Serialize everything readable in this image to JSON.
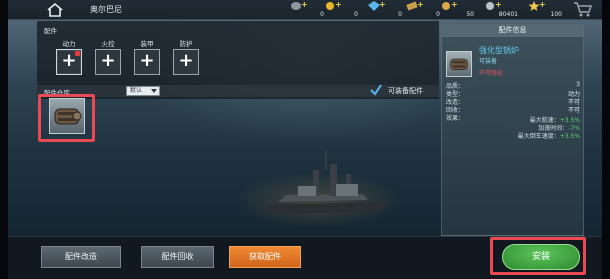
{
  "header": {
    "ship_name": "奥尔巴尼",
    "resources": [
      {
        "icon": "oil-icon",
        "value": "0"
      },
      {
        "icon": "gold-coin-icon",
        "value": "0"
      },
      {
        "icon": "diamond-icon",
        "value": "0"
      },
      {
        "icon": "ticket-icon",
        "value": "0"
      },
      {
        "icon": "medal-icon",
        "value": "50"
      },
      {
        "icon": "silver-coin-icon",
        "value": "80401"
      },
      {
        "icon": "star-icon",
        "value": "100"
      }
    ]
  },
  "parts": {
    "section_label": "配件",
    "slots": [
      {
        "label": "动力",
        "symbol": "+"
      },
      {
        "label": "火控",
        "symbol": "+"
      },
      {
        "label": "装甲",
        "symbol": "+"
      },
      {
        "label": "防护",
        "symbol": "+"
      }
    ]
  },
  "inventory": {
    "label": "配件仓库",
    "filter_value": "默认",
    "equippable_label": "可装备配件",
    "equippable_checked": true
  },
  "info": {
    "header": "配件信息",
    "name": "强化型锅炉",
    "sub1": "可装备",
    "sub2": "不可强化",
    "stats": [
      {
        "key": "品质：",
        "value": "3"
      },
      {
        "key": "类型：",
        "value": "动力"
      },
      {
        "key": "改造：",
        "value": "不可"
      },
      {
        "key": "回收：",
        "value": "不可"
      }
    ],
    "effect_label": "效果：",
    "bonuses": [
      {
        "key": "最大航速：",
        "value": "+3.5%"
      },
      {
        "key": "加速时间：",
        "value": "-7%"
      },
      {
        "key": "最大倒车速度：",
        "value": "+3.5%"
      }
    ]
  },
  "actions": {
    "modify": "配件改造",
    "recycle": "配件回收",
    "acquire": "获取配件",
    "install": "安装"
  },
  "colors": {
    "accent_orange": "#e8782a",
    "install_green": "#3fa43f",
    "highlight_red": "#ea4a54",
    "name_blue": "#62c9e8",
    "bonus_green": "#59d36a"
  }
}
